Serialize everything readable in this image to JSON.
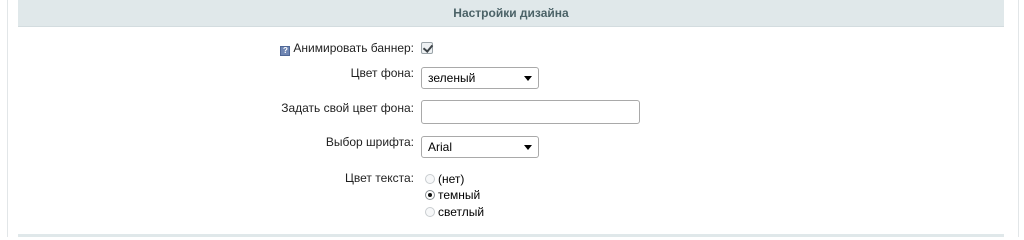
{
  "section": {
    "title": "Настройки дизайна"
  },
  "form": {
    "animate_banner": {
      "label": "Анимировать баннер:",
      "hint_icon": "help-icon",
      "checked": true
    },
    "bg_color": {
      "label": "Цвет фона:",
      "selected": "зеленый"
    },
    "custom_bg_color": {
      "label": "Задать свой цвет фона:",
      "value": ""
    },
    "font": {
      "label": "Выбор шрифта:",
      "selected": "Arial"
    },
    "text_color": {
      "label": "Цвет текста:",
      "options": [
        {
          "label": "(нет)",
          "checked": false
        },
        {
          "label": "темный",
          "checked": true
        },
        {
          "label": "светлый",
          "checked": false
        }
      ]
    }
  },
  "colors": {
    "header_bg": "#e0e8ea",
    "header_text": "#4b6267"
  }
}
